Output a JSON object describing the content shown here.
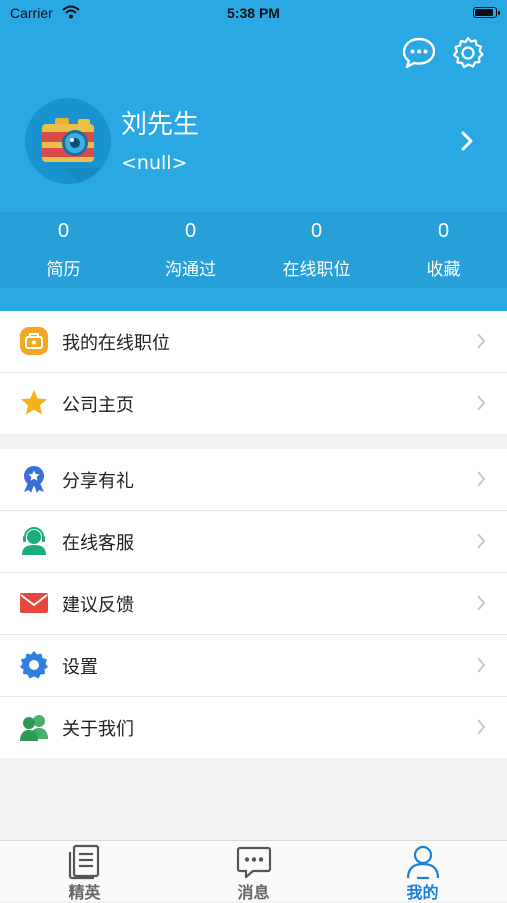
{
  "status_bar": {
    "carrier": "Carrier",
    "time": "5:38 PM"
  },
  "header": {
    "icons": [
      "chat-bubble-icon",
      "settings-gear-icon"
    ],
    "user_name": "刘先生",
    "user_subtitle": "<null>",
    "accent_color": "#2aa8e4"
  },
  "stats": [
    {
      "value": "0",
      "label": "简历"
    },
    {
      "value": "0",
      "label": "沟通过"
    },
    {
      "value": "0",
      "label": "在线职位"
    },
    {
      "value": "0",
      "label": "收藏"
    }
  ],
  "menu_group_1": [
    {
      "label": "我的在线职位",
      "icon": "job-briefcase-icon"
    },
    {
      "label": "公司主页",
      "icon": "star-icon"
    }
  ],
  "menu_group_2": [
    {
      "label": "分享有礼",
      "icon": "award-badge-icon"
    },
    {
      "label": "在线客服",
      "icon": "customer-service-icon"
    },
    {
      "label": "建议反馈",
      "icon": "mail-icon"
    },
    {
      "label": "设置",
      "icon": "gear-icon"
    },
    {
      "label": "关于我们",
      "icon": "people-icon"
    }
  ],
  "tabbar": [
    {
      "label": "精英",
      "icon": "document-icon",
      "active": false
    },
    {
      "label": "消息",
      "icon": "message-icon",
      "active": false
    },
    {
      "label": "我的",
      "icon": "profile-icon",
      "active": true
    }
  ]
}
